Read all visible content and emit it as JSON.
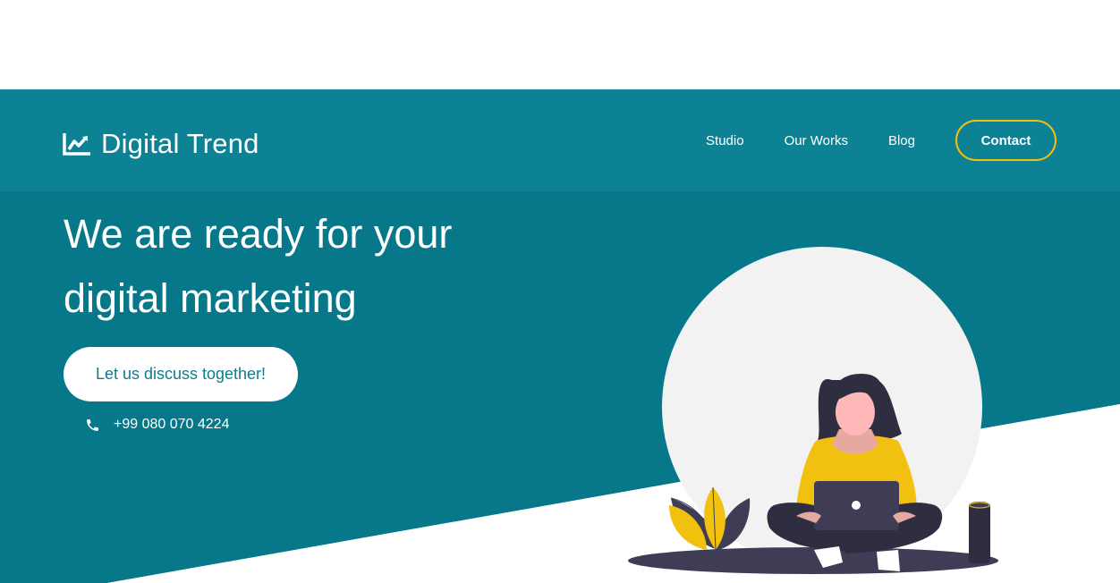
{
  "colors": {
    "hero_teal": "#06788a",
    "header_teal": "#0d8294",
    "accent_yellow": "#f2c10f",
    "white": "#ffffff",
    "dark_purple": "#3f3d56"
  },
  "logo": {
    "text": "Digital Trend",
    "icon": "trend-chart-icon"
  },
  "nav": {
    "items": [
      {
        "label": "Studio"
      },
      {
        "label": "Our Works"
      },
      {
        "label": "Blog"
      }
    ],
    "contact_label": "Contact"
  },
  "hero": {
    "headline_line1": "We are ready for your",
    "headline_line2": "digital marketing",
    "cta_label": "Let us discuss together!",
    "phone": "+99 080 070 4224",
    "phone_icon": "phone-icon",
    "illustration": "woman-with-laptop-illustration"
  }
}
